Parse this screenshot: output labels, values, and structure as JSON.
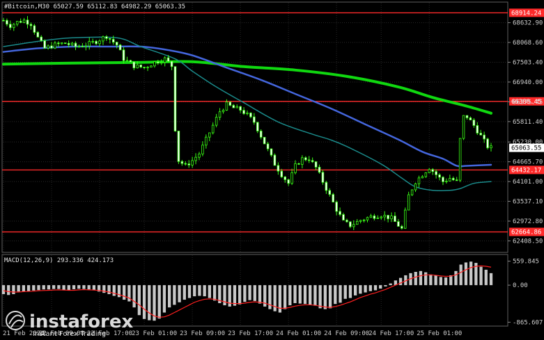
{
  "chart_data": [
    {
      "type": "candlestick",
      "header": "#Bitcoin,M30  65027.59 65112.83 64982.29 65063.35",
      "ylim": [
        62100,
        69200
      ],
      "y_ticks": [
        "68632.90",
        "68068.60",
        "67503.40",
        "66940.00",
        "66375.45",
        "65811.40",
        "65230.00",
        "64665.70",
        "64101.00",
        "63537.10",
        "62972.80",
        "62408.50"
      ],
      "x_labels": [
        "21 Feb 2024",
        "22 Feb 09:00",
        "22 Feb 17:00",
        "23 Feb 01:00",
        "23 Feb 09:00",
        "23 Feb 17:00",
        "24 Feb 01:00",
        "24 Feb 09:00",
        "24 Feb 17:00",
        "25 Feb 01:00"
      ],
      "horizontal_levels": [
        {
          "label": "68914.24",
          "value": 68914.24,
          "color": "#ff2a2a"
        },
        {
          "label": "66388.45",
          "value": 66388.45,
          "color": "#ff2a2a"
        },
        {
          "label": "64432.17",
          "value": 64432.17,
          "color": "#ff2a2a"
        },
        {
          "label": "62664.86",
          "value": 62664.86,
          "color": "#ff2a2a"
        }
      ],
      "current_price": {
        "label": "65063.55",
        "value": 65063.55
      },
      "close_path": [
        [
          0,
          68700
        ],
        [
          2,
          68550
        ],
        [
          4,
          68650
        ],
        [
          6,
          68700
        ],
        [
          8,
          68600
        ],
        [
          10,
          68200
        ],
        [
          12,
          67900
        ],
        [
          15,
          68000
        ],
        [
          18,
          68050
        ],
        [
          21,
          67950
        ],
        [
          24,
          68000
        ],
        [
          27,
          68100
        ],
        [
          30,
          68250
        ],
        [
          33,
          68000
        ],
        [
          35,
          67600
        ],
        [
          38,
          67400
        ],
        [
          41,
          67350
        ],
        [
          44,
          67500
        ],
        [
          47,
          67600
        ],
        [
          49,
          67400
        ],
        [
          50,
          65600
        ],
        [
          51,
          64700
        ],
        [
          53,
          64550
        ],
        [
          55,
          64700
        ],
        [
          57,
          64900
        ],
        [
          59,
          65300
        ],
        [
          61,
          65700
        ],
        [
          63,
          66100
        ],
        [
          65,
          66300
        ],
        [
          67,
          66200
        ],
        [
          69,
          66150
        ],
        [
          71,
          66000
        ],
        [
          73,
          65800
        ],
        [
          75,
          65400
        ],
        [
          77,
          65000
        ],
        [
          79,
          64600
        ],
        [
          81,
          64300
        ],
        [
          83,
          64050
        ],
        [
          85,
          64550
        ],
        [
          87,
          64750
        ],
        [
          89,
          64750
        ],
        [
          91,
          64500
        ],
        [
          93,
          64100
        ],
        [
          95,
          63700
        ],
        [
          97,
          63300
        ],
        [
          99,
          62950
        ],
        [
          101,
          62850
        ],
        [
          104,
          63000
        ],
        [
          107,
          63100
        ],
        [
          110,
          63150
        ],
        [
          113,
          63050
        ],
        [
          115,
          62850
        ],
        [
          116,
          62750
        ],
        [
          118,
          63700
        ],
        [
          120,
          64100
        ],
        [
          122,
          64300
        ],
        [
          124,
          64500
        ],
        [
          126,
          64300
        ],
        [
          128,
          64100
        ],
        [
          130,
          64200
        ],
        [
          132,
          64100
        ],
        [
          133,
          65300
        ],
        [
          134,
          65950
        ],
        [
          135,
          65950
        ],
        [
          137,
          65700
        ],
        [
          139,
          65400
        ],
        [
          141,
          65100
        ],
        [
          142,
          65063
        ]
      ],
      "n_bars": 143,
      "moving_averages": [
        {
          "color": "#10d810",
          "width": 4,
          "points": [
            [
              0,
              67450
            ],
            [
              20,
              67480
            ],
            [
              40,
              67500
            ],
            [
              55,
              67520
            ],
            [
              70,
              67380
            ],
            [
              85,
              67280
            ],
            [
              100,
              67100
            ],
            [
              115,
              66800
            ],
            [
              125,
              66500
            ],
            [
              135,
              66250
            ],
            [
              142,
              66050
            ]
          ]
        },
        {
          "color": "#4466dd",
          "width": 2.5,
          "points": [
            [
              0,
              67800
            ],
            [
              10,
              67900
            ],
            [
              20,
              67950
            ],
            [
              30,
              67950
            ],
            [
              40,
              67950
            ],
            [
              48,
              67850
            ],
            [
              55,
              67700
            ],
            [
              65,
              67350
            ],
            [
              75,
              67000
            ],
            [
              85,
              66600
            ],
            [
              95,
              66200
            ],
            [
              105,
              65750
            ],
            [
              115,
              65300
            ],
            [
              122,
              64950
            ],
            [
              128,
              64750
            ],
            [
              132,
              64550
            ],
            [
              135,
              64550
            ],
            [
              142,
              64580
            ]
          ]
        },
        {
          "color": "#1a8a8a",
          "width": 1.5,
          "points": [
            [
              0,
              67950
            ],
            [
              10,
              68100
            ],
            [
              20,
              68200
            ],
            [
              33,
              68200
            ],
            [
              40,
              67950
            ],
            [
              50,
              67600
            ],
            [
              55,
              67250
            ],
            [
              62,
              66800
            ],
            [
              70,
              66350
            ],
            [
              80,
              65800
            ],
            [
              90,
              65450
            ],
            [
              95,
              65300
            ],
            [
              100,
              65100
            ],
            [
              110,
              64600
            ],
            [
              116,
              64200
            ],
            [
              120,
              63950
            ],
            [
              125,
              63850
            ],
            [
              130,
              63850
            ],
            [
              133,
              63900
            ],
            [
              137,
              64050
            ],
            [
              142,
              64100
            ]
          ]
        }
      ]
    },
    {
      "type": "bar",
      "title": "MACD(12,26,9) 293.336 424.173",
      "ylim": [
        -940,
        700
      ],
      "y_ticks": [
        "559.845",
        "0.00",
        "-865.607"
      ],
      "histogram": [
        -210,
        -230,
        -210,
        -150,
        -150,
        -140,
        -125,
        -115,
        -100,
        -100,
        -90,
        -90,
        -120,
        -120,
        -95,
        -85,
        -90,
        -100,
        -110,
        -150,
        -180,
        -210,
        -250,
        -280,
        -340,
        -380,
        -520,
        -700,
        -790,
        -820,
        -830,
        -780,
        -640,
        -520,
        -460,
        -400,
        -340,
        -300,
        -260,
        -250,
        -260,
        -300,
        -360,
        -420,
        -470,
        -500,
        -480,
        -450,
        -390,
        -350,
        -370,
        -430,
        -500,
        -560,
        -610,
        -640,
        -560,
        -470,
        -420,
        -430,
        -440,
        -460,
        -480,
        -540,
        -560,
        -540,
        -440,
        -410,
        -320,
        -300,
        -240,
        -200,
        -170,
        -140,
        -120,
        -80,
        -30,
        40,
        110,
        170,
        230,
        280,
        310,
        330,
        300,
        250,
        230,
        190,
        180,
        230,
        330,
        480,
        530,
        550,
        520,
        430,
        360,
        280
      ],
      "signal": [
        -130,
        -150,
        -160,
        -160,
        -150,
        -145,
        -140,
        -130,
        -125,
        -120,
        -115,
        -110,
        -115,
        -120,
        -120,
        -110,
        -105,
        -110,
        -115,
        -125,
        -140,
        -160,
        -190,
        -220,
        -260,
        -300,
        -380,
        -460,
        -560,
        -650,
        -720,
        -750,
        -740,
        -700,
        -640,
        -580,
        -520,
        -460,
        -400,
        -360,
        -330,
        -320,
        -330,
        -360,
        -390,
        -420,
        -430,
        -430,
        -420,
        -400,
        -390,
        -400,
        -420,
        -460,
        -500,
        -540,
        -540,
        -520,
        -490,
        -470,
        -460,
        -460,
        -470,
        -490,
        -510,
        -520,
        -500,
        -470,
        -430,
        -390,
        -340,
        -290,
        -250,
        -210,
        -180,
        -140,
        -100,
        -50,
        0,
        50,
        100,
        150,
        190,
        220,
        240,
        240,
        230,
        215,
        205,
        210,
        240,
        300,
        360,
        410,
        440,
        450,
        440,
        420
      ]
    }
  ],
  "watermark": {
    "brand": "instaforex",
    "tagline": "Instant Forex Trading"
  }
}
